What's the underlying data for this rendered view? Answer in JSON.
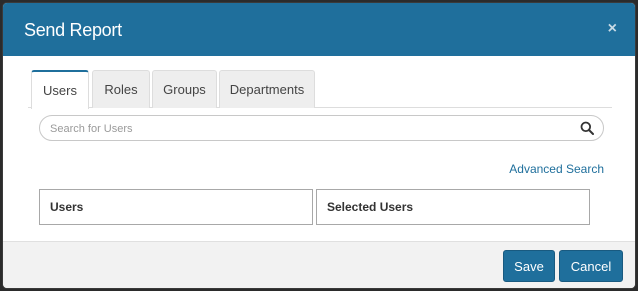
{
  "dialog": {
    "title": "Send Report",
    "close_glyph": "×"
  },
  "tabs": [
    {
      "label": "Users",
      "active": true
    },
    {
      "label": "Roles",
      "active": false
    },
    {
      "label": "Groups",
      "active": false
    },
    {
      "label": "Departments",
      "active": false
    }
  ],
  "search": {
    "placeholder": "Search for Users",
    "value": "",
    "icon": "search-icon"
  },
  "advanced_search_label": "Advanced Search",
  "lists": {
    "users_header": "Users",
    "selected_users_header": "Selected Users"
  },
  "footer": {
    "save_label": "Save",
    "cancel_label": "Cancel"
  },
  "colors": {
    "accent": "#1f6f9c",
    "header_bg": "#1f6f9c",
    "footer_bg": "#f2f2f2"
  }
}
